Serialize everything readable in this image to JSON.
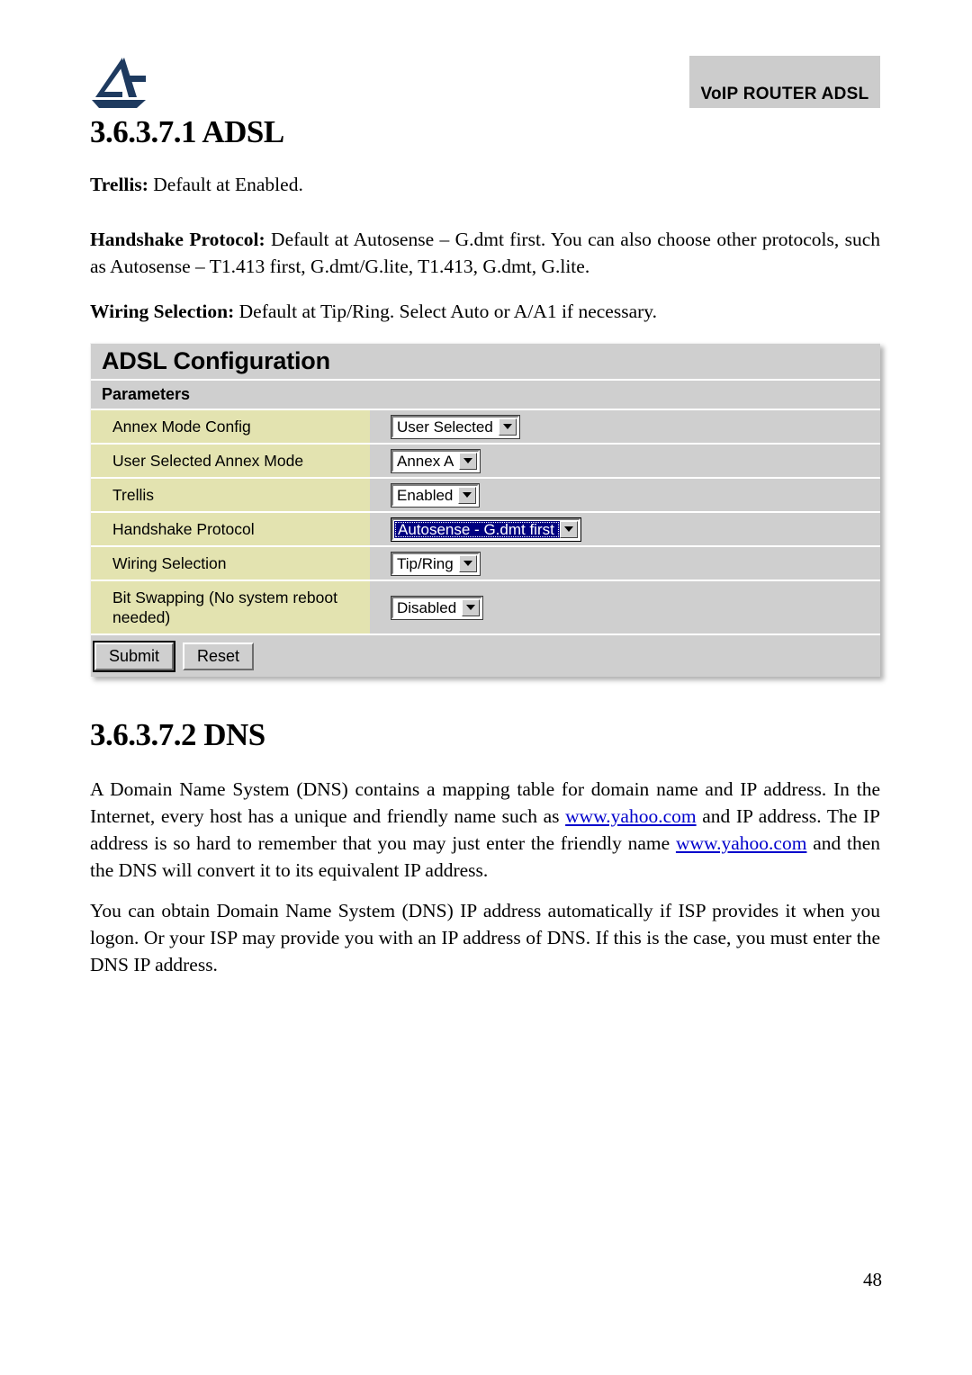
{
  "header": {
    "logo_name": "atlantis-logo",
    "device_banner": "VoIP ROUTER ADSL"
  },
  "sections": {
    "adsl": {
      "heading": "3.6.3.7.1 ADSL",
      "paragraphs": {
        "trellis": {
          "lead": "Trellis:",
          "text": " Default at Enabled."
        },
        "handshake": {
          "lead": "Handshake Protocol:",
          "text": " Default at Autosense – G.dmt first. You can also choose other protocols, such as Autosense – T1.413 first, G.dmt/G.lite, T1.413, G.dmt, G.lite."
        },
        "wiring": {
          "lead": "Wiring Selection:",
          "text": " Default at Tip/Ring. Select Auto or A/A1 if necessary."
        }
      }
    },
    "dns": {
      "heading": "3.6.3.7.2 DNS",
      "paragraph_1": {
        "part_1": "A Domain Name System (DNS) contains a mapping table for domain name and IP address. In the Internet, every host has a unique and friendly name such as ",
        "link_1": "www.yahoo.com",
        "part_2": " and IP address. The IP address is so hard to remember that you may just enter the friendly name ",
        "link_2": "www.yahoo.com",
        "part_3": " and then the DNS will convert it to its equivalent IP address."
      },
      "paragraph_2": "You can obtain Domain Name System (DNS) IP address automatically if ISP provides it when you logon. Or your ISP may provide you with an IP address of DNS. If this is the case, you must enter the DNS IP address."
    }
  },
  "config_panel": {
    "title": "ADSL Configuration",
    "subtitle": "Parameters",
    "rows": [
      {
        "label": "Annex Mode Config",
        "value": "User Selected",
        "focused": false
      },
      {
        "label": "User Selected Annex Mode",
        "value": "Annex A",
        "focused": false
      },
      {
        "label": "Trellis",
        "value": "Enabled",
        "focused": false
      },
      {
        "label": "Handshake Protocol",
        "value": "Autosense - G.dmt first",
        "focused": true
      },
      {
        "label": "Wiring Selection",
        "value": "Tip/Ring",
        "focused": false
      },
      {
        "label": "Bit Swapping (No system reboot needed)",
        "value": "Disabled",
        "focused": false
      }
    ],
    "buttons": {
      "submit": "Submit",
      "reset": "Reset"
    },
    "colors": {
      "panel_bg": "#cfcfcf",
      "label_bg": "#e3e3b0",
      "focus_bg": "#000080",
      "focus_fg": "#ffffff"
    }
  },
  "footer": {
    "page_number": "48"
  }
}
